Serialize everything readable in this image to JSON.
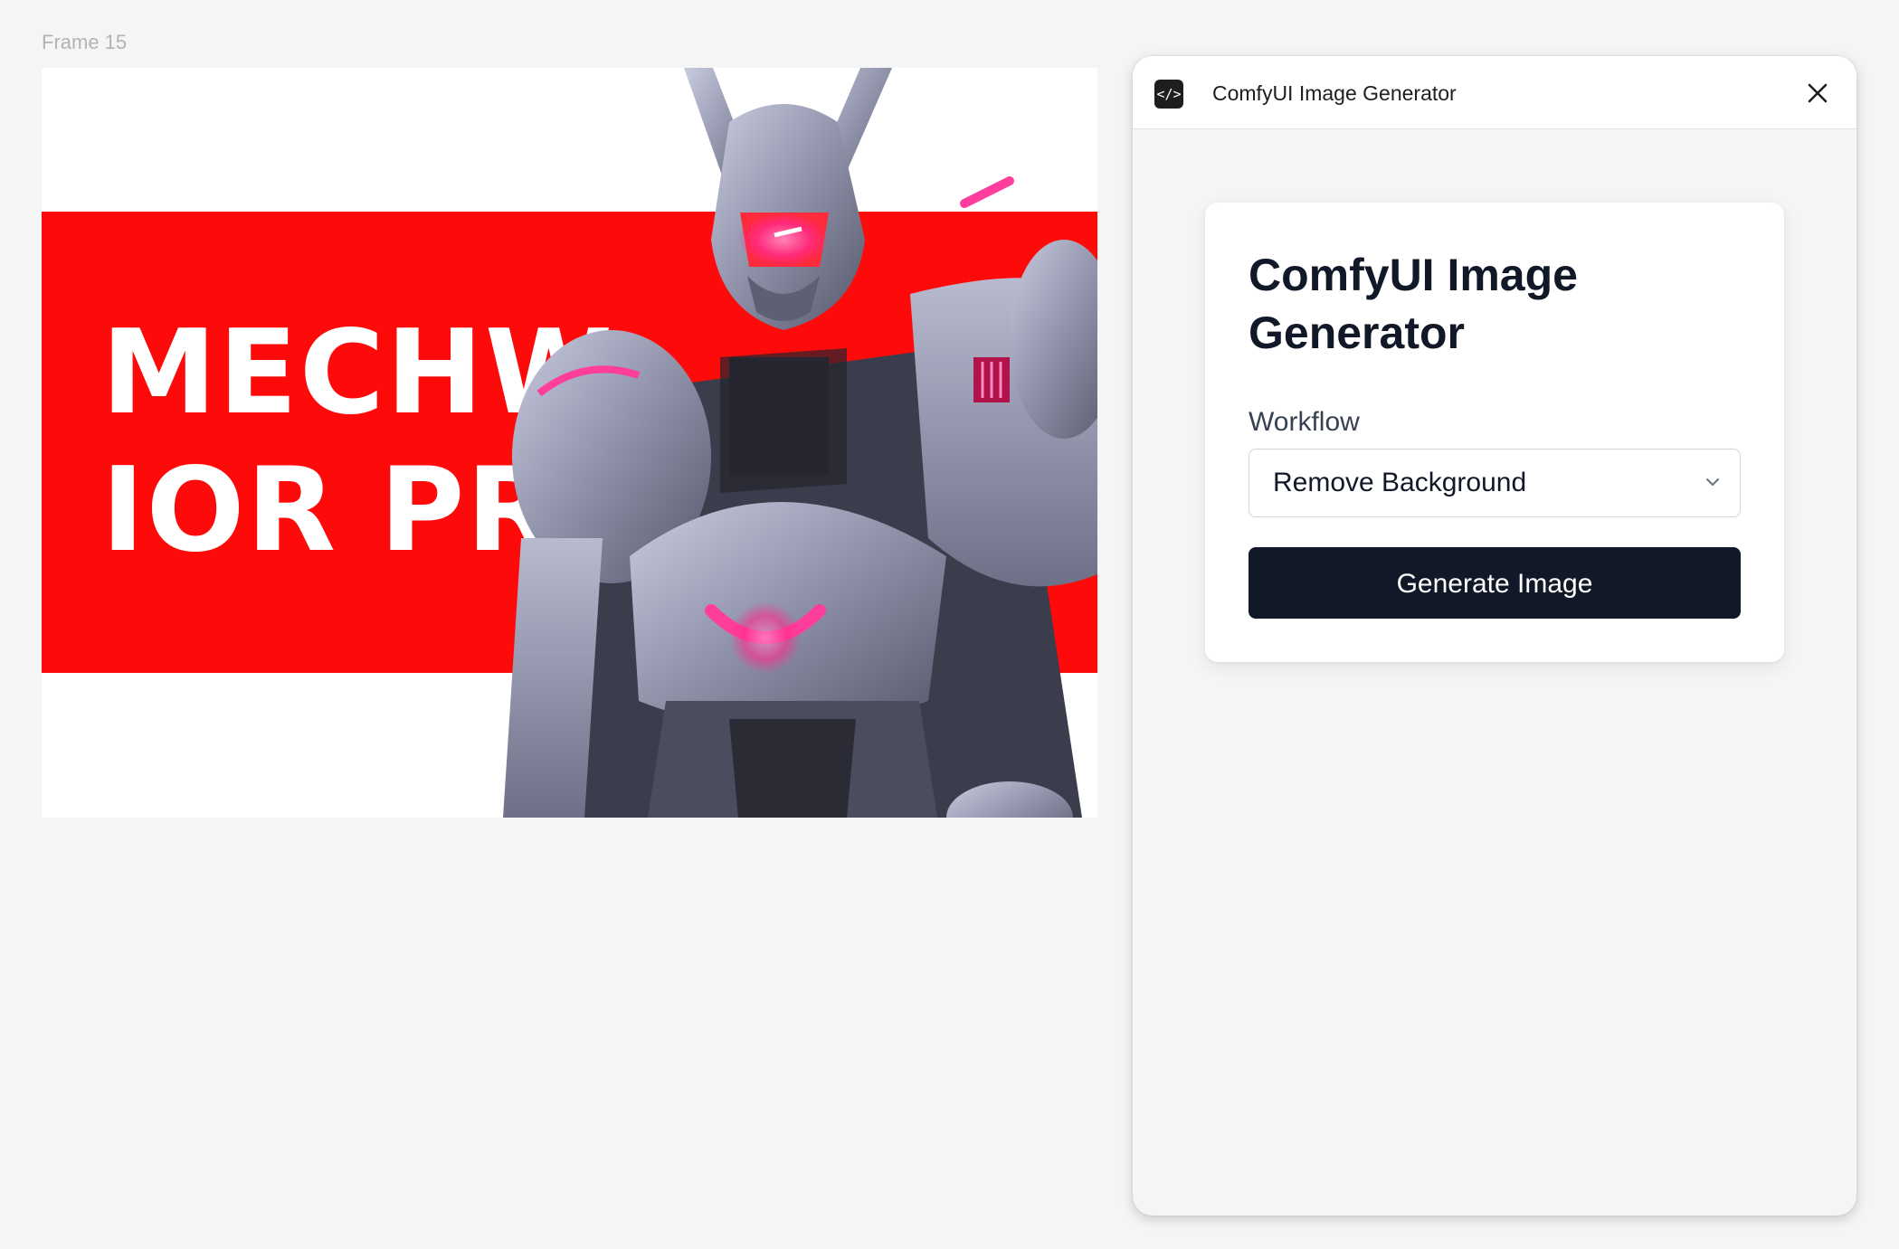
{
  "canvas": {
    "frame_label": "Frame 15"
  },
  "banner": {
    "line1": "MECHW",
    "line2": "IOR PRO",
    "band_color": "#ff0a0a"
  },
  "plugin": {
    "icon": "code-icon",
    "icon_glyph": "</>",
    "title": "ComfyUI Image Generator",
    "close_icon": "close-icon"
  },
  "form": {
    "heading": "ComfyUI Image Generator",
    "workflow_label": "Workflow",
    "workflow_selected": "Remove Background",
    "generate_label": "Generate Image",
    "button_color": "#111827"
  }
}
